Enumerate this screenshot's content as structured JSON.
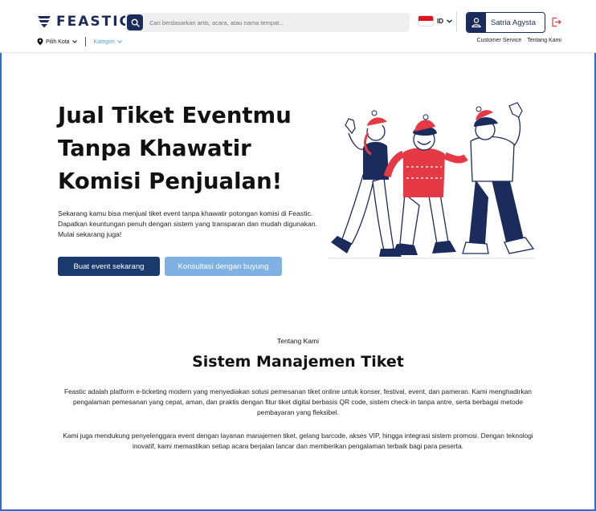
{
  "header": {
    "brand": "FEASTIC",
    "search_placeholder": "Cari berdasarkan artis, acara, atau nama tempat...",
    "language": "ID",
    "user_name": "Satria Agysta",
    "city_label": "Pilih Kota",
    "category_label": "Kategori",
    "links": [
      "Customer Service",
      "Tentang Kami"
    ]
  },
  "hero": {
    "title": "Jual Tiket Eventmu Tanpa Khawatir Komisi Penjualan!",
    "description": "Sekarang kamu bisa menjual tiket event tanpa khawatir potongan komisi di Feastic. Dapatkan keuntungan penuh dengan sistem yang transparan dan mudah digunakan. Mulai sekarang juga!",
    "primary_button": "Buat event sekarang",
    "secondary_button": "Konsultasi dengan buyung"
  },
  "about": {
    "label": "Tentang Kami",
    "title": "Sistem Manajemen Tiket",
    "paragraph1": "Feastic adalah platform e-ticketing modern yang menyediakan solusi pemesanan tiket online untuk konser, festival, event, dan pameran. Kami menghadirkan pengalaman pemesanan yang cepat, aman, dan praktis dengan fitur tiket digital berbasis QR code, sistem check-in tanpa antre, serta berbagai metode pembayaran yang fleksibel.",
    "paragraph2": "Kami juga mendukung penyelenggara event dengan layanan manajemen tiket, gelang barcode, akses VIP, hingga integrasi sistem promosi. Dengan teknologi inovatif, kami memastikan setiap acara berjalan lancar dan memberikan pengalaman terbaik bagi para peserta."
  },
  "colors": {
    "brand_navy": "#1a2b5c",
    "primary_button": "#1a3a6e",
    "secondary_button": "#7fb1e3",
    "accent_red": "#e63946",
    "frame_border": "#2b6fd6"
  },
  "icons": [
    "feastic-logo-icon",
    "search-icon",
    "flag-id-icon",
    "chevron-down-icon",
    "user-icon",
    "logout-icon",
    "location-pin-icon"
  ]
}
